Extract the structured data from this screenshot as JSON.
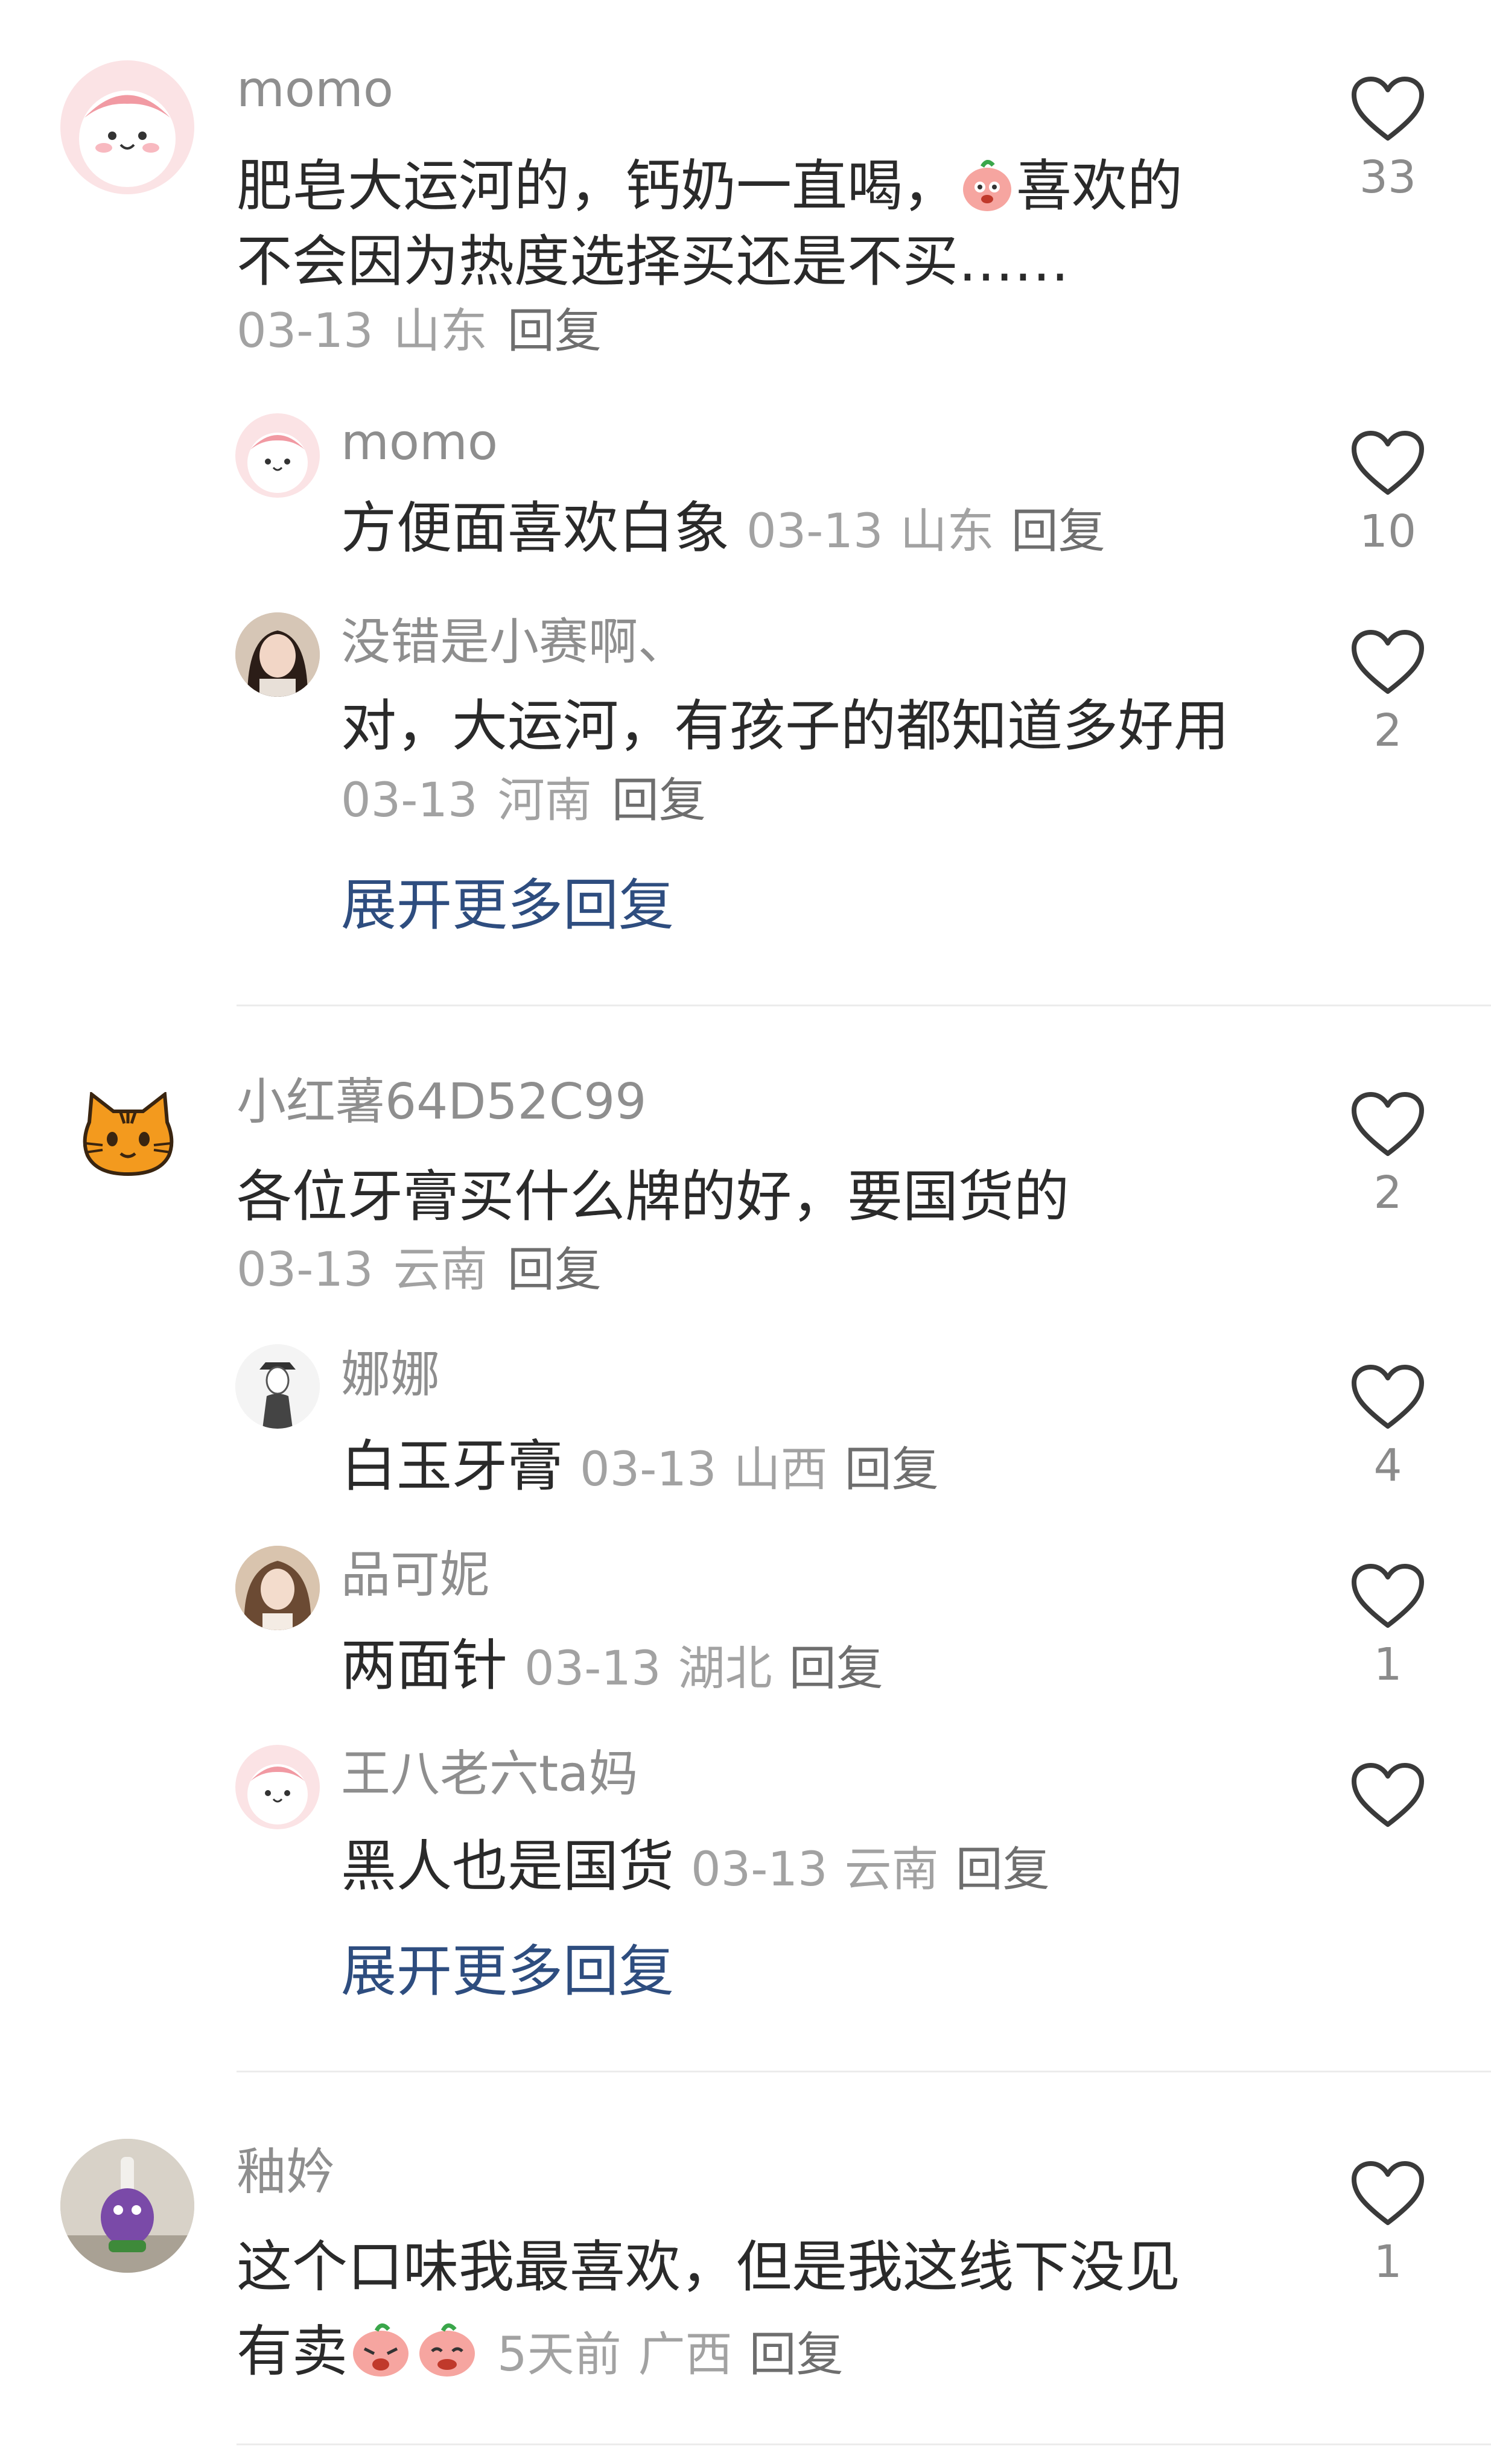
{
  "comments": [
    {
      "username": "momo",
      "avatar": "pink-bun-avatar",
      "text_line1_a": "肥皂大运河的，钙奶一直喝，",
      "text_line1_b": "喜欢的",
      "text_line2": "不会因为热度选择买还是不买……",
      "date": "03-13",
      "location": "山东",
      "reply_label": "回复",
      "likes": "33",
      "replies": [
        {
          "username": "momo",
          "avatar": "pink-bun-avatar",
          "text": "方便面喜欢白象",
          "date": "03-13",
          "location": "山东",
          "reply_label": "回复",
          "likes": "10"
        },
        {
          "username": "没错是小赛啊、",
          "avatar": "girl-photo-avatar",
          "text": "对，大运河，有孩子的都知道多好用",
          "date": "03-13",
          "location": "河南",
          "reply_label": "回复",
          "likes": "2"
        }
      ],
      "expand_label": "展开更多回复"
    },
    {
      "username": "小红薯64D52C99",
      "avatar": "orange-cat-avatar",
      "text": "各位牙膏买什么牌的好，要国货的",
      "date": "03-13",
      "location": "云南",
      "reply_label": "回复",
      "likes": "2",
      "replies": [
        {
          "username": "娜娜",
          "avatar": "sketch-girl-avatar",
          "text": "白玉牙膏",
          "date": "03-13",
          "location": "山西",
          "reply_label": "回复",
          "likes": "4"
        },
        {
          "username": "品可妮",
          "avatar": "curly-hair-girl-avatar",
          "text": "两面针",
          "date": "03-13",
          "location": "湖北",
          "reply_label": "回复",
          "likes": "1"
        },
        {
          "username": "王八老六ta妈",
          "avatar": "pink-bun-avatar",
          "text": "黑人也是国货",
          "date": "03-13",
          "location": "云南",
          "reply_label": "回复",
          "likes": ""
        }
      ],
      "expand_label": "展开更多回复"
    },
    {
      "username": "釉妗",
      "avatar": "purple-doll-avatar",
      "text_line1": "这个口味我最喜欢，但是我这线下没见",
      "text_line2": "有卖",
      "time": "5天前",
      "location": "广西",
      "reply_label": "回复",
      "likes": "1"
    }
  ],
  "icons": {
    "like": "heart-outline-icon",
    "emoji": "peach-emoji-icon"
  },
  "colors": {
    "username": "#8e8e8e",
    "text": "#2a2a2a",
    "meta": "#a2a2a2",
    "expand_link": "#2e4d7f",
    "heart_outline": "#3a3a3a"
  }
}
